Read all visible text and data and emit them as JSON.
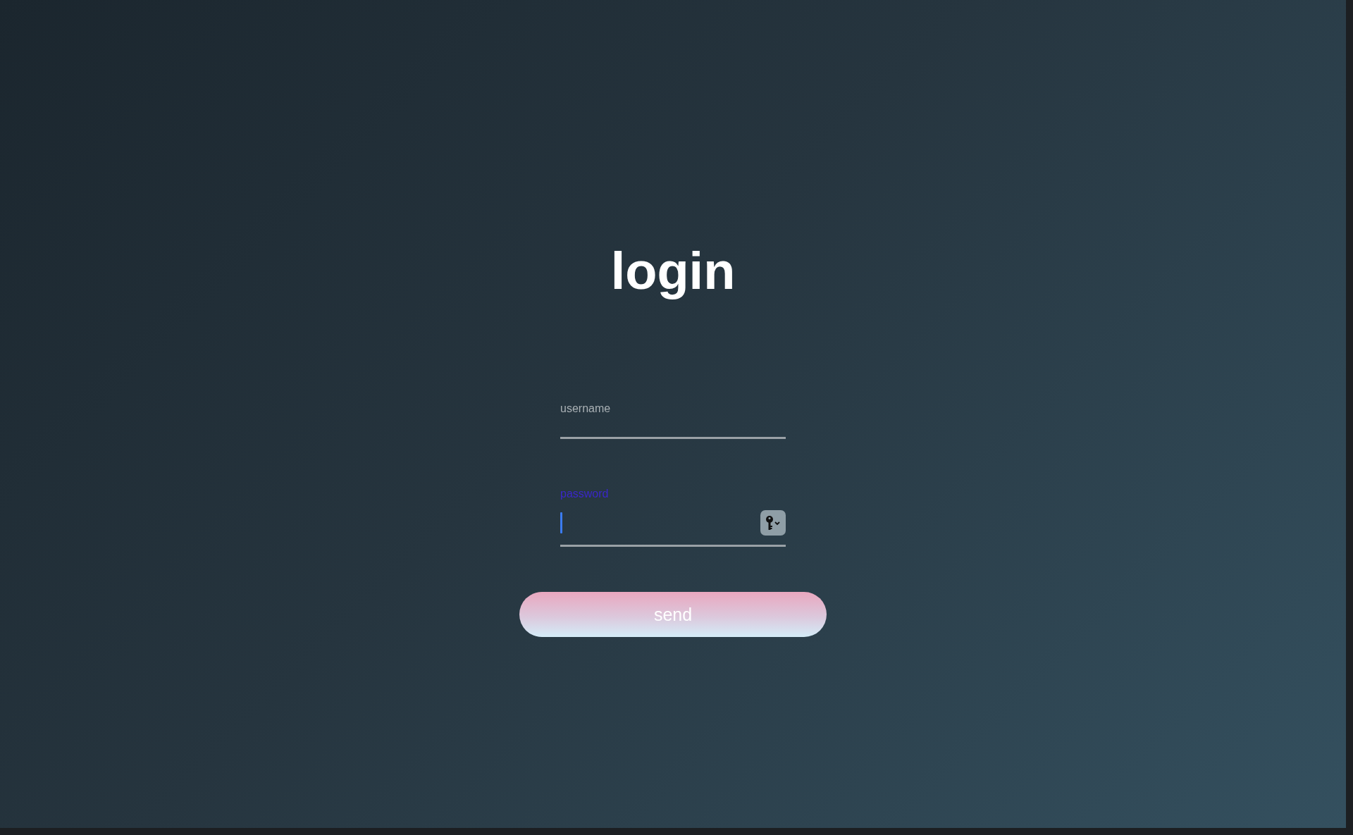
{
  "title": "login",
  "fields": [
    {
      "label": "username",
      "kind": "text",
      "focused": false
    },
    {
      "label": "password",
      "kind": "password",
      "focused": true
    }
  ],
  "button": "send"
}
